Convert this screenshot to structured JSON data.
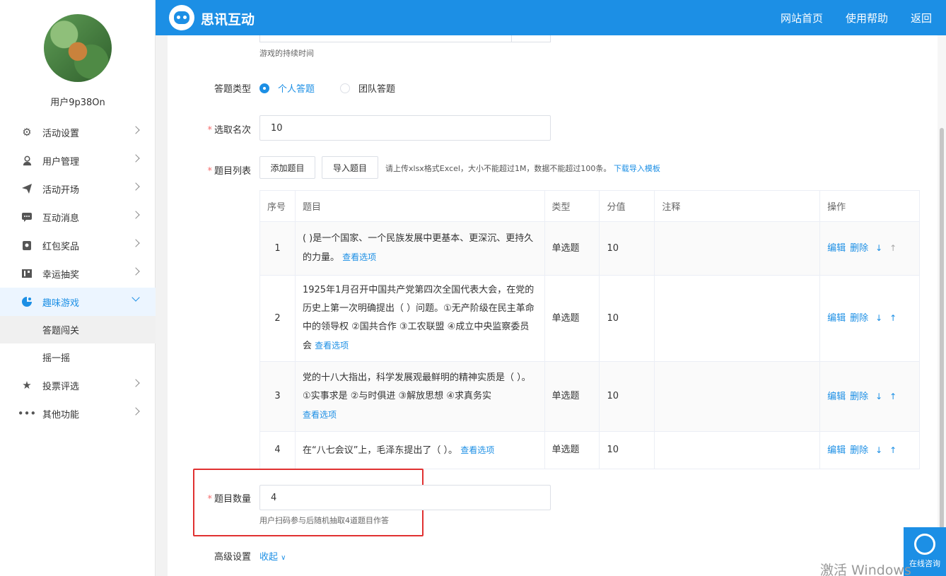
{
  "header": {
    "brand": "思讯互动",
    "nav": [
      "网站首页",
      "使用帮助",
      "返回"
    ]
  },
  "sidebar": {
    "username": "用户9p38On",
    "menu": [
      {
        "label": "活动设置",
        "icon": "gear-icon"
      },
      {
        "label": "用户管理",
        "icon": "user-icon"
      },
      {
        "label": "活动开场",
        "icon": "send-icon"
      },
      {
        "label": "互动消息",
        "icon": "chat-icon"
      },
      {
        "label": "红包奖品",
        "icon": "gift-icon"
      },
      {
        "label": "幸运抽奖",
        "icon": "lottery-icon"
      },
      {
        "label": "趣味游戏",
        "icon": "game-icon"
      },
      {
        "label": "投票评选",
        "icon": "star-icon"
      },
      {
        "label": "其他功能",
        "icon": "more-icon"
      }
    ],
    "submenu": [
      "答题闯关",
      "摇一摇"
    ]
  },
  "form": {
    "duration_hint": "游戏的持续时间",
    "answer_type_label": "答题类型",
    "answer_type_options": [
      "个人答题",
      "团队答题"
    ],
    "rank_label": "选取名次",
    "rank_value": "10",
    "question_list_label": "题目列表",
    "add_question_button": "添加题目",
    "import_question_button": "导入题目",
    "import_hint": "请上传xlsx格式Excel，大小不能超过1M，数据不能超过100条。",
    "download_template_link": "下载导入模板",
    "question_count_label": "题目数量",
    "question_count_value": "4",
    "question_count_hint": "用户扫码参与后随机抽取4道题目作答",
    "advanced_label": "高级设置",
    "collapse_link": "收起"
  },
  "table": {
    "headers": [
      "序号",
      "题目",
      "类型",
      "分值",
      "注释",
      "操作"
    ],
    "view_options": "查看选项",
    "edit": "编辑",
    "delete": "删除",
    "move_down": "↓",
    "move_up": "↑",
    "rows": [
      {
        "no": "1",
        "question": "( )是一个国家、一个民族发展中更基本、更深沉、更持久的力量。",
        "type": "单选题",
        "score": "10",
        "note": ""
      },
      {
        "no": "2",
        "question": "1925年1月召开中国共产党第四次全国代表大会，在党的历史上第一次明确提出（ ）问题。①无产阶级在民主革命中的领导权 ②国共合作 ③工农联盟 ④成立中央监察委员会",
        "type": "单选题",
        "score": "10",
        "note": ""
      },
      {
        "no": "3",
        "question": "党的十八大指出，科学发展观最鲜明的精神实质是（ ）。①实事求是 ②与时俱进 ③解放思想 ④求真务实",
        "type": "单选题",
        "score": "10",
        "note": ""
      },
      {
        "no": "4",
        "question": "在“八七会议”上，毛泽东提出了（ ）。",
        "type": "单选题",
        "score": "10",
        "note": ""
      }
    ]
  },
  "consult_label": "在线咨询",
  "watermark": "激活 Windows"
}
